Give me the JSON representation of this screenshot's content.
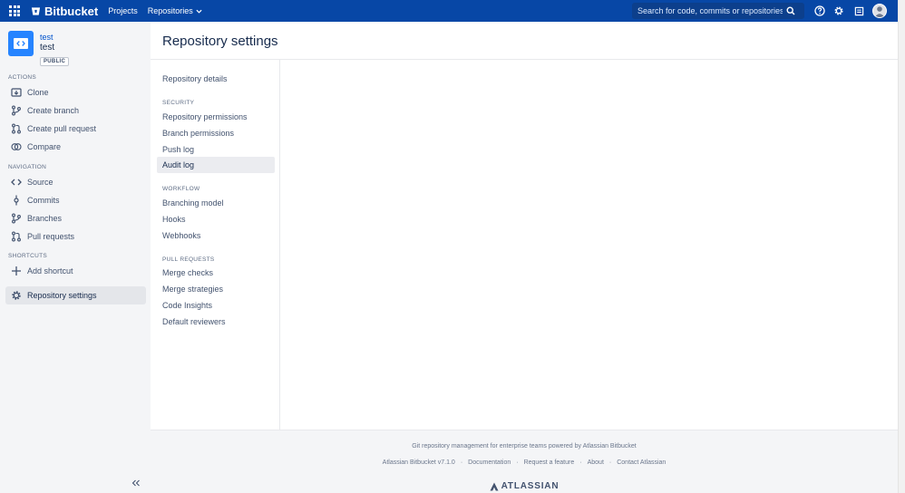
{
  "topbar": {
    "app_name": "Bitbucket",
    "nav": [
      "Projects",
      "Repositories"
    ],
    "search_placeholder": "Search for code, commits or repositories...",
    "colors": {
      "background": "#0747a6",
      "search_bg": "#0c3f8c"
    },
    "icons": [
      "apps-grid-icon",
      "bitbucket-logo-icon",
      "chevron-down-icon",
      "search-icon",
      "help-icon",
      "settings-gear-icon",
      "inbox-icon",
      "user-avatar"
    ]
  },
  "repo": {
    "project": "test",
    "name": "test",
    "badge": "PUBLIC"
  },
  "sidebar": {
    "actions_label": "ACTIONS",
    "actions": [
      {
        "label": "Clone",
        "icon": "clone-icon"
      },
      {
        "label": "Create branch",
        "icon": "branch-icon"
      },
      {
        "label": "Create pull request",
        "icon": "pull-request-icon"
      },
      {
        "label": "Compare",
        "icon": "compare-icon"
      }
    ],
    "navigation_label": "NAVIGATION",
    "navigation": [
      {
        "label": "Source",
        "icon": "code-icon"
      },
      {
        "label": "Commits",
        "icon": "commit-icon"
      },
      {
        "label": "Branches",
        "icon": "branch-icon"
      },
      {
        "label": "Pull requests",
        "icon": "pull-request-icon"
      }
    ],
    "shortcuts_label": "SHORTCUTS",
    "add_shortcut": "Add shortcut",
    "settings": "Repository settings",
    "active_color": "#e4e6ea"
  },
  "page": {
    "title": "Repository settings"
  },
  "settings_nav": {
    "details": "Repository details",
    "security_label": "SECURITY",
    "security": [
      "Repository permissions",
      "Branch permissions",
      "Push log",
      "Audit log"
    ],
    "workflow_label": "WORKFLOW",
    "workflow": [
      "Branching model",
      "Hooks",
      "Webhooks"
    ],
    "pr_label": "PULL REQUESTS",
    "pull_requests": [
      "Merge checks",
      "Merge strategies",
      "Code Insights",
      "Default reviewers"
    ],
    "active": "Audit log"
  },
  "footer": {
    "tagline": "Git repository management for enterprise teams powered by Atlassian Bitbucket",
    "links": [
      "Atlassian Bitbucket v7.1.0",
      "Documentation",
      "Request a feature",
      "About",
      "Contact Atlassian"
    ],
    "brand": "ATLASSIAN"
  }
}
